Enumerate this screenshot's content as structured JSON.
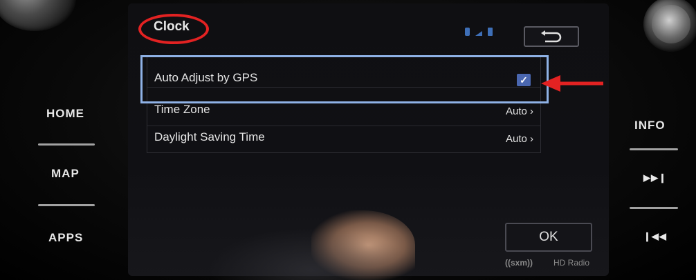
{
  "screen": {
    "title": "Clock",
    "rows": [
      {
        "label": "Auto Adjust by GPS",
        "checked": true
      },
      {
        "label": "Time Zone",
        "value": "Auto ›"
      },
      {
        "label": "Daylight Saving Time",
        "value": "Auto ›"
      }
    ],
    "ok_label": "OK",
    "brand_sxm": "((sxm))",
    "brand_hd": "HD Radio"
  },
  "hardware_left": {
    "home": "HOME",
    "map": "MAP",
    "apps": "APPS"
  },
  "hardware_right": {
    "info": "INFO",
    "next_icon": "skip-forward-icon",
    "prev_icon": "skip-back-icon"
  },
  "colors": {
    "title_circle": "#e32222",
    "highlight_box": "#8fb2e6",
    "arrow": "#e32222",
    "checkbox": "#4a67b0",
    "status_icons": "#3e6fb7"
  }
}
